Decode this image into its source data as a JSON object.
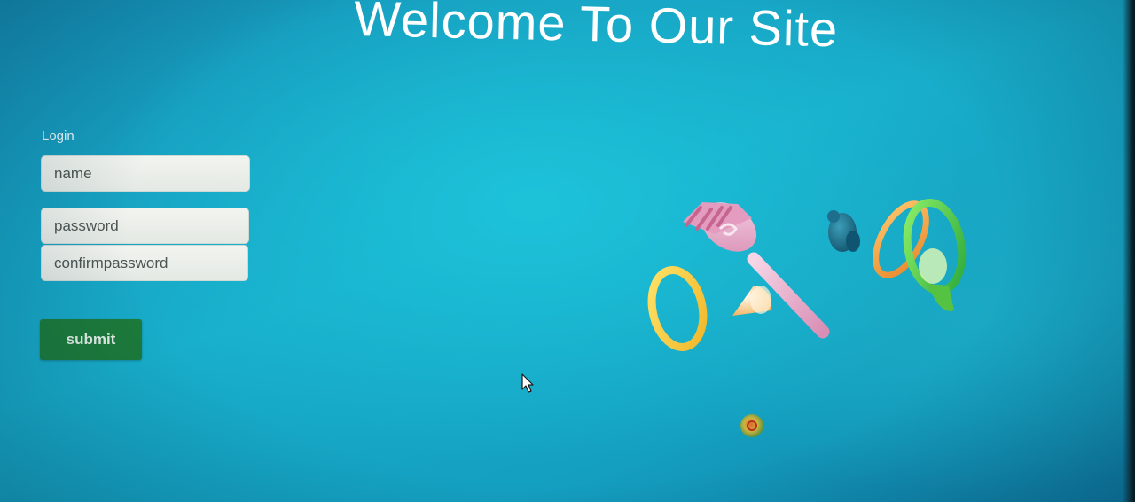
{
  "page": {
    "title": "Welcome To Our Site"
  },
  "login_form": {
    "label": "Login",
    "name_placeholder": "name",
    "password_placeholder": "password",
    "confirm_password_placeholder": "confirmpassword",
    "submit_label": "submit"
  },
  "colors": {
    "background": "#18aecb",
    "title": "#ffffff",
    "field_background": "#eef1ec",
    "submit_background": "#1c7b3a",
    "submit_text": "#e4efe6"
  },
  "icons": {
    "cursor": "mouse-pointer-icon",
    "decorations": [
      "pink-rake-shape",
      "yellow-ring-shape",
      "cream-cone-shape",
      "teal-bear-shape",
      "orange-ring-shape",
      "green-ring-shape",
      "small-swirl-ball-shape"
    ]
  }
}
